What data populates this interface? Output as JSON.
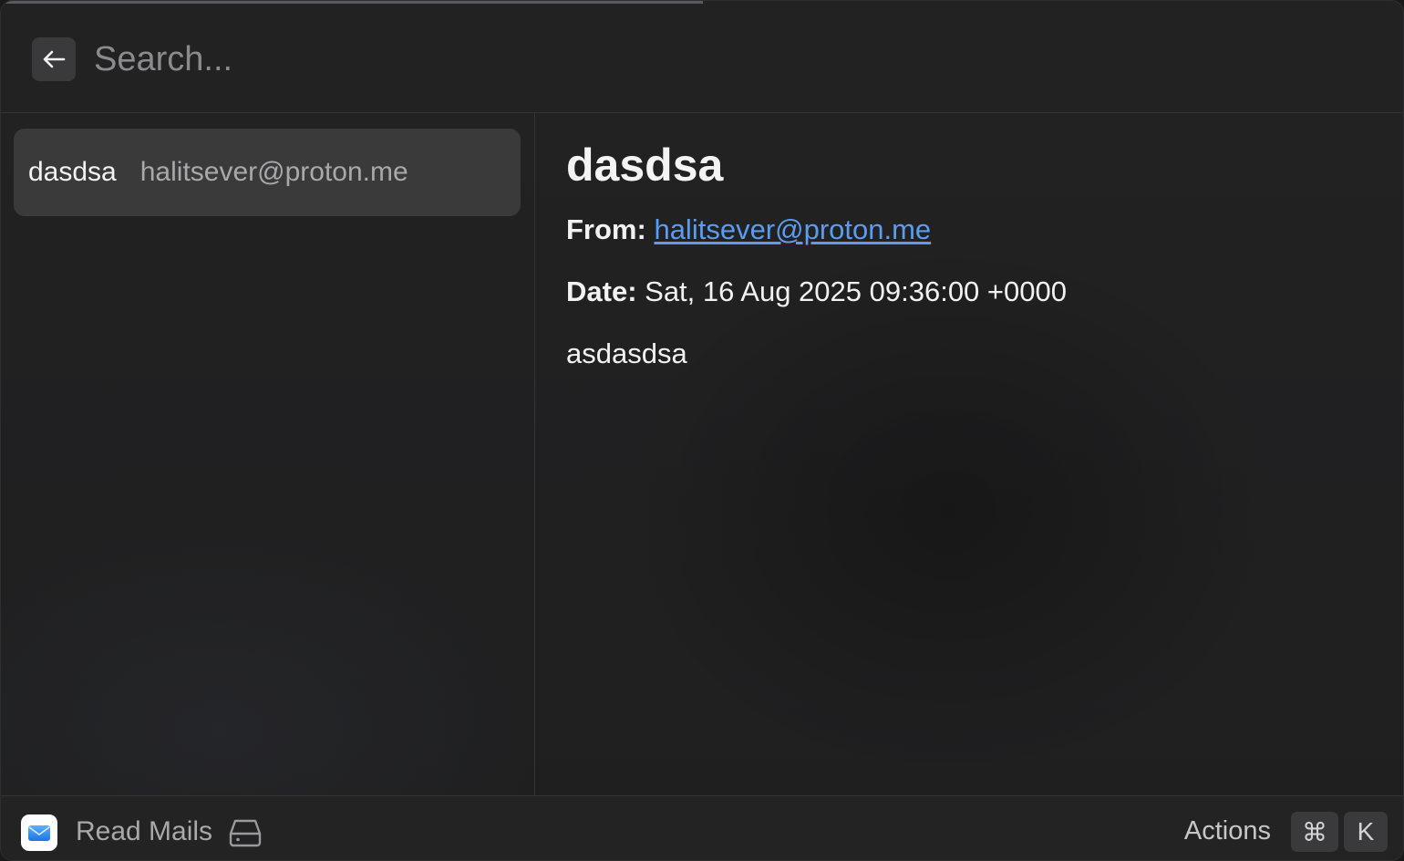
{
  "search": {
    "placeholder": "Search..."
  },
  "icons": {
    "back": "arrow-left-icon",
    "app": "mail-icon",
    "drive": "hard-drive-icon"
  },
  "mail_list": {
    "items": [
      {
        "subject": "dasdsa",
        "sender": "halitsever@proton.me",
        "selected": true
      }
    ]
  },
  "detail": {
    "title": "dasdsa",
    "from_label": "From:",
    "from_value": "halitsever@proton.me",
    "date_label": "Date:",
    "date_value": "Sat, 16 Aug 2025 09:36:00 +0000",
    "body": "asdasdsa"
  },
  "footer": {
    "title": "Read Mails",
    "actions_label": "Actions",
    "shortcut": {
      "modifier": "⌘",
      "key": "K"
    }
  },
  "colors": {
    "background": "#1f1f20",
    "selected_row": "#3a3a3b",
    "link": "#5b9cf0",
    "muted_text": "#a9a9ac"
  }
}
